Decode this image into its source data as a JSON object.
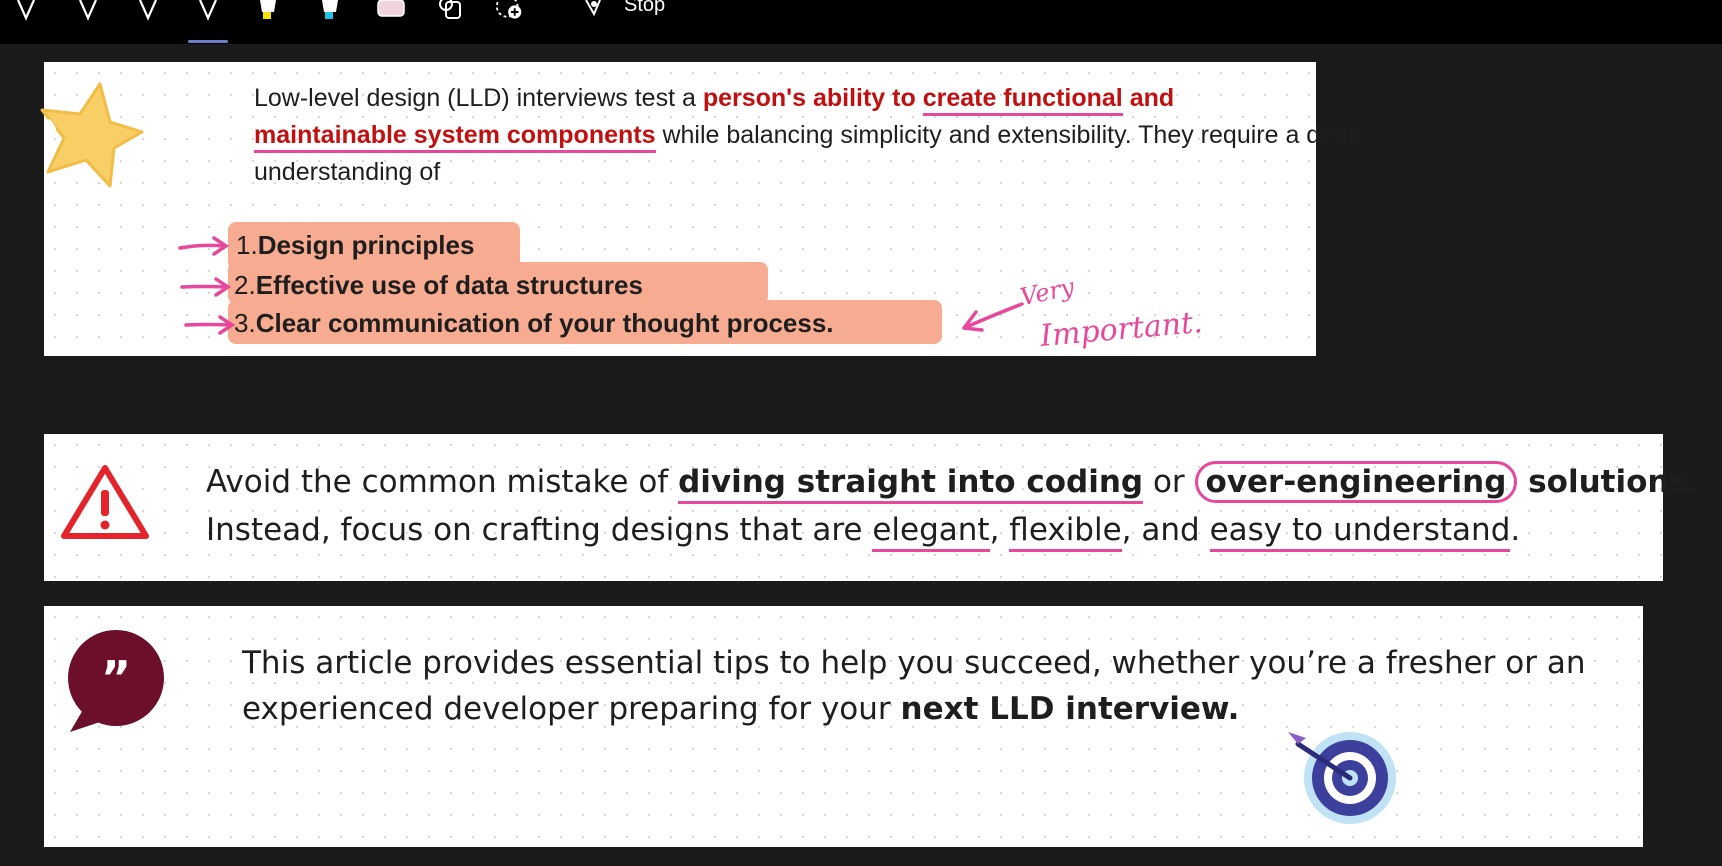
{
  "toolbar": {
    "tools": [
      "pen-icon",
      "pen-icon",
      "pen-icon",
      "pen-icon",
      "highlighter-yellow-icon",
      "highlighter-cyan-icon",
      "eraser-icon",
      "shapes-icon",
      "lasso-add-icon",
      "laser-pointer-icon"
    ],
    "stop_label": "Stop"
  },
  "card1": {
    "intro_pre": "Low-level design (LLD) interviews test a ",
    "intro_red1": "person's ability to ",
    "intro_red_underlined": "create functional",
    "intro_red_and": " and",
    "intro_red_underlined2": "maintainable system components",
    "intro_post": " while balancing simplicity and extensibility. They require a deep understanding of",
    "items": [
      {
        "num": "1.",
        "label": "Design principles"
      },
      {
        "num": "2.",
        "label": "Effective use of data structures"
      },
      {
        "num": "3.",
        "label": "Clear communication of your thought process."
      }
    ],
    "annotation_line1": "Very",
    "annotation_line2": "Important."
  },
  "card2": {
    "line1_pre": "Avoid the common mistake of ",
    "line1_bold1": "diving straight into coding",
    "line1_mid": " or ",
    "line1_bold2": "over-engineering",
    "line1_end": " solutions.",
    "line2_pre": "Instead, focus on crafting designs that are ",
    "line2_w1": "elegant",
    "line2_sep1": ", ",
    "line2_w2": "flexible",
    "line2_sep2": ", and ",
    "line2_w3": "easy to understand",
    "line2_end": "."
  },
  "card3": {
    "line1": "This article provides essential tips to help you succeed, whether you’re a fresher or an",
    "line2_pre": "experienced developer preparing for your ",
    "line2_bold": "next LLD interview."
  },
  "colors": {
    "accent_red": "#c21010",
    "ink_pink": "#e8489c",
    "list_highlight": "#f7ab90",
    "quote_bubble": "#6b0f2a",
    "warning_red": "#e3242b"
  }
}
